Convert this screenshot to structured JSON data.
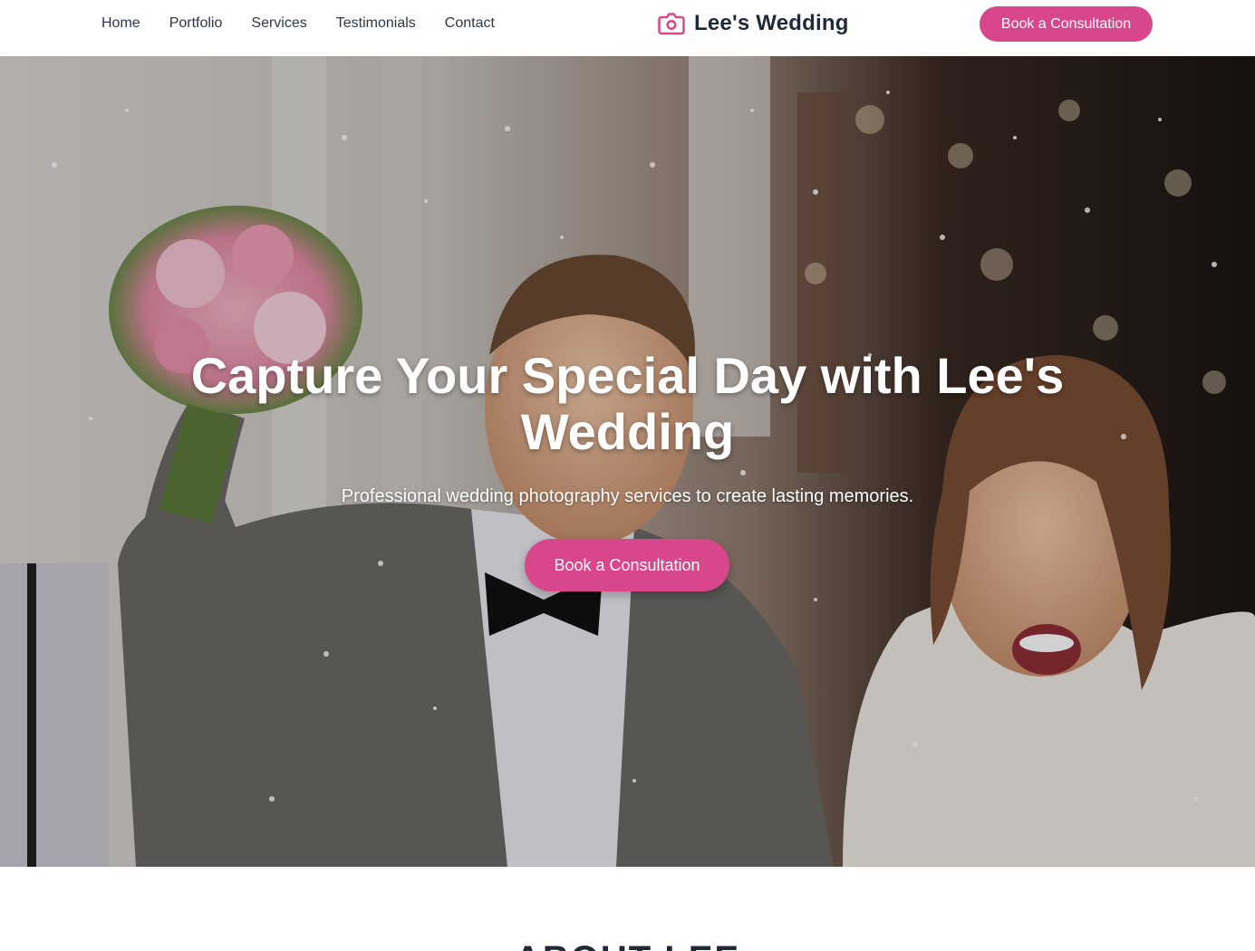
{
  "nav": {
    "items": [
      "Home",
      "Portfolio",
      "Services",
      "Testimonials",
      "Contact"
    ]
  },
  "brand": {
    "name": "Lee's Wedding",
    "icon": "camera-icon",
    "accent": "#d8468c"
  },
  "header": {
    "cta_label": "Book a Consultation"
  },
  "hero": {
    "title": "Capture Your Special Day with Lee's Wedding",
    "subtitle": "Professional wedding photography services to create lasting memories.",
    "cta_label": "Book a Consultation"
  },
  "about": {
    "title": "ABOUT LEE"
  },
  "colors": {
    "accent": "#d8468c",
    "text_dark": "#1f2937"
  }
}
